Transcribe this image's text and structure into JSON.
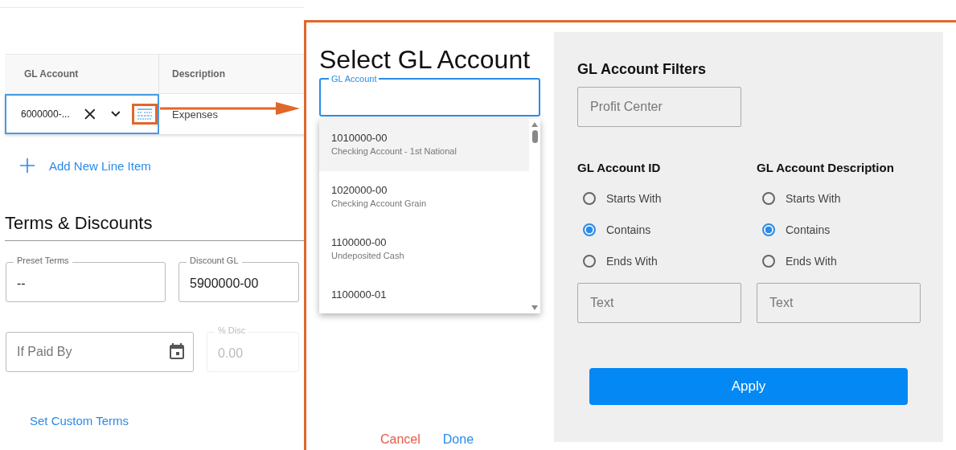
{
  "table": {
    "columns": [
      "GL Account",
      "Description"
    ],
    "rows": [
      {
        "cells": [
          {
            "text": "6000000-...",
            "focused": true
          },
          {
            "text": "Expenses"
          }
        ]
      }
    ]
  },
  "add_line_item": "Add New Line Item",
  "terms": {
    "title": "Terms & Discounts",
    "rows": [
      [
        {
          "kind": "text",
          "label": "Preset Terms",
          "value": "--",
          "disabled": false
        },
        {
          "kind": "text",
          "label": "Discount GL",
          "value": "5900000-00",
          "disabled": false
        }
      ],
      [
        {
          "kind": "date",
          "placeholder": "If Paid By",
          "disabled": false
        },
        {
          "kind": "text",
          "label": "% Disc",
          "value": "0.00",
          "disabled": true
        }
      ]
    ],
    "custom_terms_link": "Set Custom Terms"
  },
  "modal": {
    "title": "Select GL Account",
    "search": {
      "label": "GL Account",
      "focused": true
    },
    "accounts": [
      {
        "id": "1010000-00",
        "name": "Checking Account - 1st National",
        "selected": true
      },
      {
        "id": "1020000-00",
        "name": "Checking Account Grain",
        "selected": false
      },
      {
        "id": "1100000-00",
        "name": "Undeposited Cash",
        "selected": false
      },
      {
        "id": "1100000-01",
        "selected": false
      }
    ],
    "cancel": "Cancel",
    "done": "Done",
    "filters": {
      "title": "GL Account Filters",
      "profit_center_placeholder": "Profit Center",
      "groups": [
        {
          "title": "GL Account ID",
          "options": [
            {
              "label": "Starts With",
              "selected": false
            },
            {
              "label": "Contains",
              "selected": true
            },
            {
              "label": "Ends With",
              "selected": false
            }
          ],
          "text_placeholder": "Text"
        },
        {
          "title": "GL Account Description",
          "options": [
            {
              "label": "Starts With",
              "selected": false
            },
            {
              "label": "Contains",
              "selected": true
            },
            {
              "label": "Ends With",
              "selected": false
            }
          ],
          "text_placeholder": "Text"
        }
      ],
      "apply": "Apply"
    }
  }
}
